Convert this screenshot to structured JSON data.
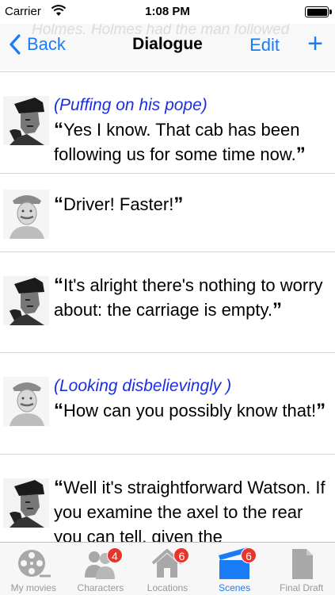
{
  "status_bar": {
    "carrier": "Carrier",
    "time": "1:08 PM"
  },
  "nav": {
    "back_label": "Back",
    "title": "Dialogue",
    "edit_label": "Edit",
    "add_label": "+",
    "ghost_text": "Holmes. Holmes had the man followed"
  },
  "dialogue": [
    {
      "character_icon": "holmes-portrait",
      "parenthetical": "(Puffing on his pope)",
      "open_quote": "“",
      "line": "Yes I know. That cab has been following us for some time now.",
      "close_quote": "”"
    },
    {
      "character_icon": "watson-portrait",
      "parenthetical": "",
      "open_quote": "“",
      "line": "Driver! Faster!",
      "close_quote": "”"
    },
    {
      "character_icon": "holmes-portrait",
      "parenthetical": "",
      "open_quote": "“",
      "line": "It's alright there's nothing to worry about: the carriage is empty.",
      "close_quote": "”"
    },
    {
      "character_icon": "watson-portrait",
      "parenthetical": "(Looking disbelievingly )",
      "open_quote": "“",
      "line": "How can you possibly know that!",
      "close_quote": "”"
    },
    {
      "character_icon": "holmes-portrait",
      "parenthetical": "",
      "open_quote": "“",
      "line": "Well it's straightforward Watson. If you examine the axel to the rear you can tell, given the",
      "close_quote": ""
    }
  ],
  "tab_bar": {
    "tabs": [
      {
        "label": "My movies",
        "icon": "film-reel-icon",
        "badge": "",
        "active": false
      },
      {
        "label": "Characters",
        "icon": "characters-icon",
        "badge": "4",
        "active": false
      },
      {
        "label": "Locations",
        "icon": "house-icon",
        "badge": "6",
        "active": false
      },
      {
        "label": "Scenes",
        "icon": "clapperboard-icon",
        "badge": "6",
        "active": true
      },
      {
        "label": "Final Draft",
        "icon": "document-icon",
        "badge": "",
        "active": false
      }
    ]
  },
  "colors": {
    "accent": "#1a7cf5",
    "parenthetical": "#1b2fdc",
    "badge": "#e8352b"
  }
}
